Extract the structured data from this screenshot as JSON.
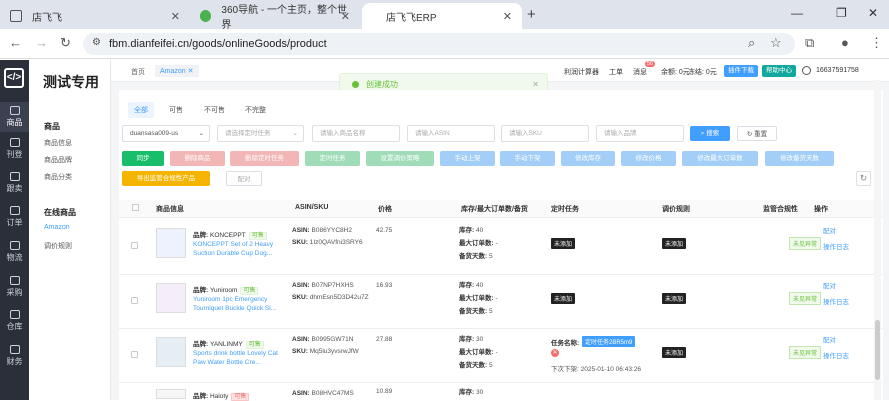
{
  "browser": {
    "tabs": [
      {
        "label": "店飞飞",
        "active": false
      },
      {
        "label": "360导航 - 一个主页，整个世界",
        "active": false
      },
      {
        "label": "店飞飞ERP",
        "active": true
      }
    ],
    "url": "fbm.dianfeifei.cn/goods/onlineGoods/product"
  },
  "nav": {
    "items": [
      "商品",
      "刊登",
      "跟卖",
      "订单",
      "物流",
      "采购",
      "仓库",
      "财务"
    ],
    "active": "商品"
  },
  "subnav": {
    "title": "测试专用",
    "groups": [
      {
        "label": "商品",
        "items": [
          "商品信息",
          "商品品牌",
          "商品分类"
        ]
      },
      {
        "label": "在线商品",
        "items": [
          "Amazon",
          "调价规则"
        ]
      }
    ]
  },
  "topbar": {
    "tabs": [
      "首页",
      "Amazon"
    ],
    "tools": [
      "利润计算器",
      "工单",
      "消息"
    ],
    "msg_badge": "56",
    "balance": "余额: 0元",
    "refund": "冻结: 0元",
    "plugin_btn": "插件下载",
    "help_btn": "帮助中心",
    "phone": "16637591758"
  },
  "toast": {
    "text": "创建成功"
  },
  "status_tabs": [
    "全部",
    "可售",
    "不可售",
    "不完整"
  ],
  "filters": {
    "store": "duansasa009-us",
    "placeholders": [
      "请选择定时任务",
      "请输入商品名称",
      "请输入ASIN",
      "请输入SKU",
      "请输入品牌"
    ],
    "search": "搜索",
    "reset": "重置"
  },
  "actions": {
    "row1": [
      "同步",
      "删除商品",
      "删除定时任务",
      "定时任务",
      "设置调价策略",
      "手动上架",
      "手动下架",
      "修改库存",
      "修改价格",
      "修改最大订单数",
      "修改备货天数"
    ],
    "row2": [
      "导出监管合规性产品",
      "配对"
    ]
  },
  "table": {
    "headers": [
      "商品信息",
      "ASIN/SKU",
      "价格",
      "库存/最大订单数/备货",
      "定时任务",
      "调价规则",
      "监管合规性",
      "操作"
    ],
    "rows": [
      {
        "brand": "KONCEPPT",
        "status": "可售",
        "title": "KONCEPPT Set of 2 Heavy Suction Durable Cup Dog...",
        "asin": "B086YYC8H2",
        "sku": "1Iz0QAVfni3SRY6",
        "price": "42.75",
        "stock": "40",
        "max_order": "-",
        "prep": "5",
        "task": "未添加",
        "rule": "未添加",
        "compliance": "未见异常",
        "op1": "配对",
        "op2": "操作日志"
      },
      {
        "brand": "Yuniroom",
        "status": "可售",
        "title": "Yuniroom 1pc Emergency Tourniquet Buckle Quick Sl...",
        "asin": "B07NP7HXHS",
        "sku": "dhmEsn5D3D42u7Z",
        "price": "16.93",
        "stock": "40",
        "max_order": "-",
        "prep": "5",
        "task": "未添加",
        "rule": "未添加",
        "compliance": "未见异常",
        "op1": "配对",
        "op2": "操作日志"
      },
      {
        "brand": "YANLINMY",
        "status": "可售",
        "title": "Sports drink bottle Lovely Cat Paw Water Bottle Cre...",
        "asin": "B0995GW71N",
        "sku": "Mq5lu3yvsrwJfW",
        "price": "27.88",
        "stock": "30",
        "max_order": "-",
        "prep": "5",
        "task_name": "定时任务2BR5m9",
        "task_next": "下次下架: 2025-01-10 06:43:26",
        "rule": "未添加",
        "compliance": "未见异常",
        "op1": "配对",
        "op2": "操作日志"
      },
      {
        "brand": "Haloty",
        "status": "可售",
        "asin": "B08HVC47MS",
        "price": "10.89",
        "stock": "30"
      }
    ]
  },
  "colors": {
    "primary": "#409eff",
    "success": "#67c23a",
    "danger": "#f56c6c",
    "sidebar": "#2b2f3a"
  }
}
